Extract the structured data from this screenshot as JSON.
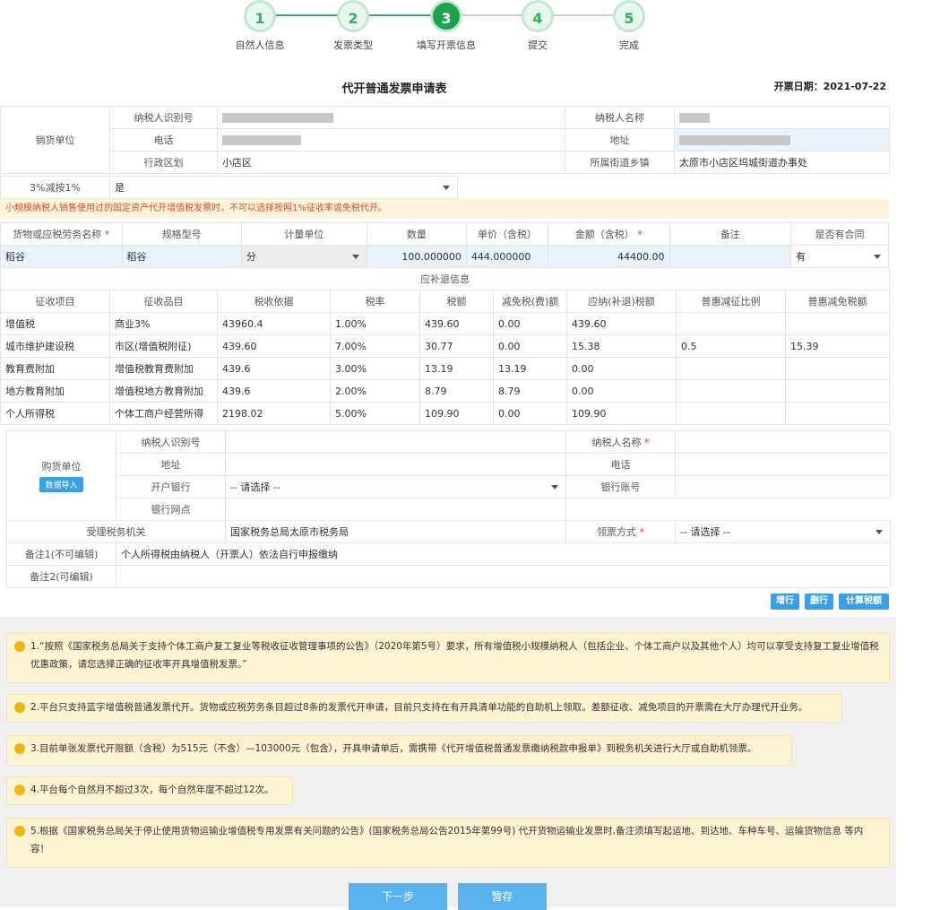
{
  "steps": [
    {
      "num": "1",
      "label": "自然人信息"
    },
    {
      "num": "2",
      "label": "发票类型"
    },
    {
      "num": "3",
      "label": "填写开票信息"
    },
    {
      "num": "4",
      "label": "提交"
    },
    {
      "num": "5",
      "label": "完成"
    }
  ],
  "colors": {
    "accent": "#1fa24e",
    "button": "#3aa0e6",
    "warning": "#e04b27"
  },
  "title": "代开普通发票申请表",
  "date": "开票日期：2021-07-22",
  "seller": {
    "section_label": "销货单位",
    "taxpayer_id_label": "纳税人识别号",
    "taxpayer_name_label": "纳税人名称",
    "phone_label": "电话",
    "address_label": "地址",
    "district_label": "行政区划",
    "district_value": "小店区",
    "street_label": "所属街道乡镇",
    "street_value": "太原市小店区坞城街道办事处"
  },
  "reduce": {
    "label": "3%减按1%",
    "value": "是"
  },
  "warning": "小规模纳税人销售使用过的固定资产代开增值税发票时，不可以选择按照1%征收率或免税代开。",
  "goods": {
    "headers": [
      "货物或应税劳务名称",
      "规格型号",
      "计量单位",
      "数量",
      "单价（含税）",
      "金额（含税）",
      "备注",
      "是否有合同"
    ],
    "row": {
      "name": "稻谷",
      "spec": "稻谷",
      "unit": "分",
      "qty": "100.000000",
      "price": "444.000000",
      "amount": "44400.00",
      "remark": "",
      "contract": "有"
    }
  },
  "tax": {
    "section_label": "应补退信息",
    "headers": [
      "征收项目",
      "征收品目",
      "税收依据",
      "税率",
      "税额",
      "减免税(费)额",
      "应纳(补退)税额",
      "普惠减征比例",
      "普惠减免税额"
    ],
    "rows": [
      [
        "增值税",
        "商业3%",
        "43960.4",
        "1.00%",
        "439.60",
        "0.00",
        "439.60",
        "",
        ""
      ],
      [
        "城市维护建设税",
        "市区(增值税附征)",
        "439.60",
        "7.00%",
        "30.77",
        "0.00",
        "15.38",
        "0.5",
        "15.39"
      ],
      [
        "教育费附加",
        "增值税教育费附加",
        "439.6",
        "3.00%",
        "13.19",
        "13.19",
        "0.00",
        "",
        ""
      ],
      [
        "地方教育附加",
        "增值税地方教育附加",
        "439.6",
        "2.00%",
        "8.79",
        "8.79",
        "0.00",
        "",
        ""
      ],
      [
        "个人所得税",
        "个体工商户经营所得",
        "2198.02",
        "5.00%",
        "109.90",
        "0.00",
        "109.90",
        "",
        ""
      ]
    ]
  },
  "buyer": {
    "section_label": "购货单位",
    "import_btn": "数据导入",
    "taxpayer_id_label": "纳税人识别号",
    "taxpayer_name_label": "纳税人名称",
    "address_label": "地址",
    "phone_label": "电话",
    "bank_label": "开户银行",
    "bank_placeholder": "-- 请选择 --",
    "account_label": "银行账号",
    "branch_label": "银行网点"
  },
  "authority": {
    "label": "受理税务机关",
    "value": "国家税务总局太原市税务局",
    "pickup_label": "领票方式",
    "pickup_value": "-- 请选择 --"
  },
  "remark1": {
    "label": "备注1(不可编辑)",
    "value": "个人所得税由纳税人（开票人）依法自行申报缴纳"
  },
  "remark2": {
    "label": "备注2(可编辑)"
  },
  "actions": {
    "add": "增行",
    "del": "删行",
    "calc": "计算税额"
  },
  "notices": [
    "1.“按照《国家税务总局关于支持个体工商户复工复业等税收征收管理事项的公告》（2020年第5号）要求，所有增值税小规模纳税人（包括企业、个体工商户以及其他个人）均可以享受支持复工复业增值税优惠政策，请您选择正确的征收率开具增值税发票。”",
    "2.平台只支持蓝字增值税普通发票代开。货物或应税劳务条目超过8条的发票代开申请，目前只支持在有开具清单功能的自助机上领取。差额征收、减免项目的开票需在大厅办理代开业务。",
    "3.目前单张发票代开限额（含税）为515元（不含）—103000元（包含），开具申请单后，需携带《代开增值税普通发票缴纳税款申报单》到税务机关进行大厅或自助机领票。",
    "4.平台每个自然月不超过3次，每个自然年度不超过12次。",
    "5.根据《国家税务总局关于停止使用货物运输业增值税专用发票有关问题的公告》(国家税务总局公告2015年第99号) 代开货物运输业发票时,备注须填写起运地、到达地、车种车号、运输货物信息 等内容！"
  ],
  "footer": {
    "next": "下一步",
    "save": "暂存"
  }
}
